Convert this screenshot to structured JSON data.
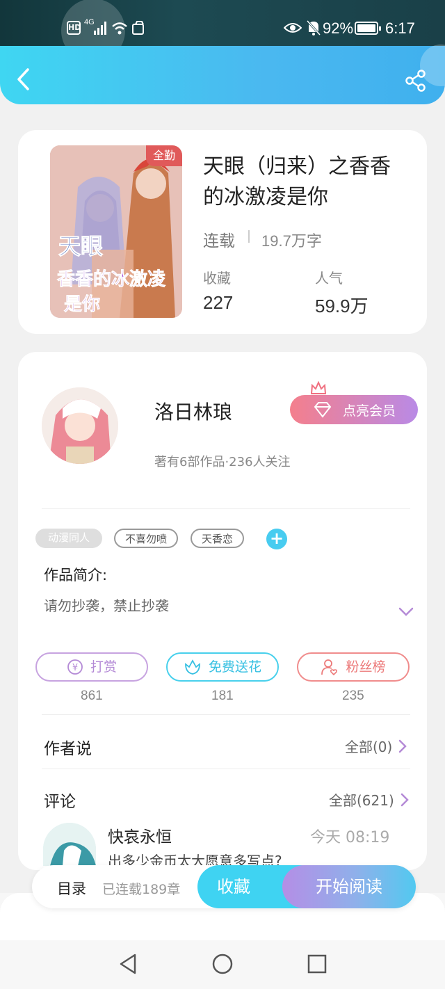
{
  "status_bar": {
    "network": "4G",
    "battery": "92%",
    "time": "6:17",
    "hd": "HD"
  },
  "header": {
    "back_icon": "chevron-left-icon",
    "share_icon": "share-icon"
  },
  "book": {
    "badge": "全勤",
    "cover_title_line1": "天眼",
    "cover_title_line2": "香香的冰激凌",
    "cover_title_line3": "是你",
    "title": "天眼（归来）之香香的冰激凌是你",
    "status": "连载",
    "word_count": "19.7万字",
    "favorites_label": "收藏",
    "favorites_value": "227",
    "popularity_label": "人气",
    "popularity_value": "59.9万"
  },
  "author": {
    "name": "洛日林琅",
    "stats": "著有6部作品·236人关注",
    "vip_button": "点亮会员"
  },
  "tags": [
    "动漫同人",
    "不喜勿喷",
    "天香恋"
  ],
  "intro": {
    "label": "作品简介:",
    "text": "请勿抄袭，禁止抄袭"
  },
  "actions": [
    {
      "label": "打赏",
      "count": "861",
      "color": "#c7a3e0"
    },
    {
      "label": "免费送花",
      "count": "181",
      "color": "#48d0ec"
    },
    {
      "label": "粉丝榜",
      "count": "235",
      "color": "#f08c8c"
    }
  ],
  "author_says": {
    "label": "作者说",
    "link": "全部(0)"
  },
  "comments": {
    "label": "评论",
    "link": "全部(621)",
    "first": {
      "user": "快哀永恒",
      "time": "今天 08:19",
      "text": "出多少金币太大愿意多写点?"
    }
  },
  "bottom_bar": {
    "toc": "目录",
    "chapters": "已连载189章",
    "collect": "收藏",
    "read": "开始阅读"
  },
  "colors": {
    "accent": "#3fd6f2",
    "vip_gradient_start": "#f47f8c",
    "vip_gradient_end": "#b98ae6",
    "read_gradient_start": "#b48ee6",
    "read_gradient_end": "#52c9f0"
  }
}
